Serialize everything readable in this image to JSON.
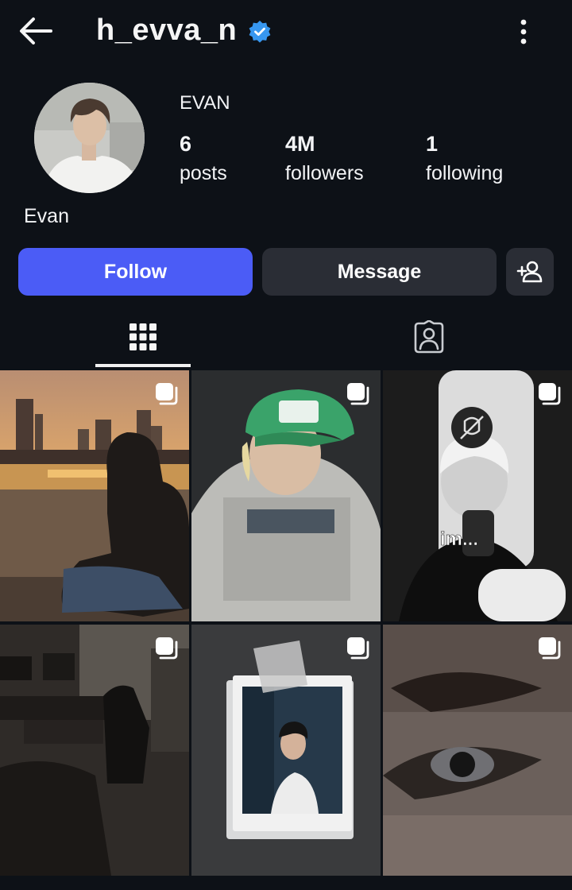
{
  "header": {
    "username": "h_evva_n",
    "verified": true,
    "icons": {
      "back": "arrow-left-icon",
      "more": "vertical-ellipsis-icon",
      "verified": "verified-badge-icon"
    }
  },
  "profile": {
    "display_name": "EVAN",
    "bio_name": "Evan",
    "stats": {
      "posts": {
        "value": "6",
        "label": "posts"
      },
      "followers": {
        "value": "4M",
        "label": "followers"
      },
      "following": {
        "value": "1",
        "label": "following"
      }
    }
  },
  "actions": {
    "follow_label": "Follow",
    "message_label": "Message",
    "add_user_icon": "person-add-icon"
  },
  "tabs": {
    "active": "grid",
    "items": [
      {
        "name": "grid",
        "icon": "grid-icon"
      },
      {
        "name": "tagged",
        "icon": "tagged-person-icon"
      }
    ]
  },
  "posts": [
    {
      "id": 1,
      "multi": true,
      "overlay_text": ""
    },
    {
      "id": 2,
      "multi": true,
      "overlay_text": ""
    },
    {
      "id": 3,
      "multi": true,
      "overlay_text": "im..."
    },
    {
      "id": 4,
      "multi": true,
      "overlay_text": ""
    },
    {
      "id": 5,
      "multi": true,
      "overlay_text": ""
    },
    {
      "id": 6,
      "multi": true,
      "overlay_text": ""
    }
  ],
  "colors": {
    "background": "#0d1117",
    "accent": "#4b5cf6",
    "button_secondary": "#2a2d35",
    "verified": "#3797f0"
  }
}
